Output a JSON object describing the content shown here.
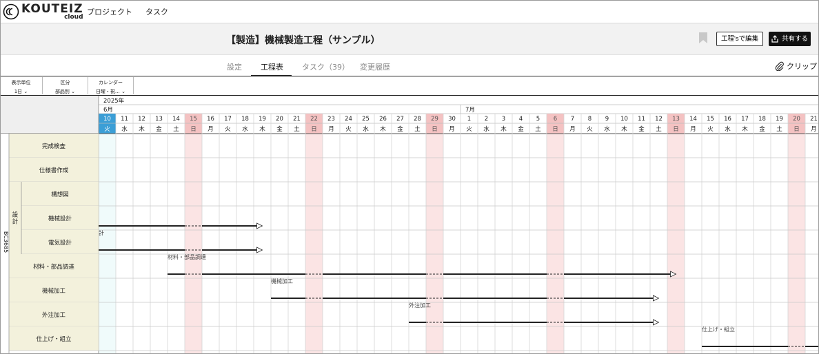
{
  "nav": {
    "logo_text": "KOUTEIZ",
    "logo_sub": "cloud",
    "items": [
      "プロジェクト",
      "タスク"
    ]
  },
  "header": {
    "title": "【製造】機械製造工程（サンプル）",
    "edit_button": "工程'sで編集",
    "share_button": "共有する"
  },
  "tabs": [
    {
      "label": "設定",
      "active": false
    },
    {
      "label": "工程表",
      "active": true
    },
    {
      "label": "タスク（39）",
      "active": false
    },
    {
      "label": "変更履歴",
      "active": false
    }
  ],
  "clip_label": "クリップ",
  "filters": [
    {
      "label": "表示単位",
      "value": "1日"
    },
    {
      "label": "区分",
      "value": "部品別"
    },
    {
      "label": "カレンダー",
      "value": "日曜・祝…"
    }
  ],
  "calendar": {
    "year": "2025年",
    "months": [
      {
        "label": "6月",
        "start_index": 0
      },
      {
        "label": "7月",
        "start_index": 21
      }
    ],
    "days": [
      {
        "d": "10",
        "w": "火",
        "type": "today"
      },
      {
        "d": "11",
        "w": "水"
      },
      {
        "d": "12",
        "w": "木"
      },
      {
        "d": "13",
        "w": "金"
      },
      {
        "d": "14",
        "w": "土"
      },
      {
        "d": "15",
        "w": "日",
        "type": "holiday"
      },
      {
        "d": "16",
        "w": "月"
      },
      {
        "d": "17",
        "w": "火"
      },
      {
        "d": "18",
        "w": "水"
      },
      {
        "d": "19",
        "w": "木"
      },
      {
        "d": "20",
        "w": "金"
      },
      {
        "d": "21",
        "w": "土"
      },
      {
        "d": "22",
        "w": "日",
        "type": "holiday"
      },
      {
        "d": "23",
        "w": "月"
      },
      {
        "d": "24",
        "w": "火"
      },
      {
        "d": "25",
        "w": "水"
      },
      {
        "d": "26",
        "w": "木"
      },
      {
        "d": "27",
        "w": "金"
      },
      {
        "d": "28",
        "w": "土"
      },
      {
        "d": "29",
        "w": "日",
        "type": "holiday"
      },
      {
        "d": "30",
        "w": "月"
      },
      {
        "d": "1",
        "w": "火"
      },
      {
        "d": "2",
        "w": "水"
      },
      {
        "d": "3",
        "w": "木"
      },
      {
        "d": "4",
        "w": "金"
      },
      {
        "d": "5",
        "w": "土"
      },
      {
        "d": "6",
        "w": "日",
        "type": "holiday"
      },
      {
        "d": "7",
        "w": "月"
      },
      {
        "d": "8",
        "w": "火"
      },
      {
        "d": "9",
        "w": "水"
      },
      {
        "d": "10",
        "w": "木"
      },
      {
        "d": "11",
        "w": "金"
      },
      {
        "d": "12",
        "w": "土"
      },
      {
        "d": "13",
        "w": "日",
        "type": "holiday"
      },
      {
        "d": "14",
        "w": "月"
      },
      {
        "d": "15",
        "w": "火"
      },
      {
        "d": "16",
        "w": "水"
      },
      {
        "d": "17",
        "w": "木"
      },
      {
        "d": "18",
        "w": "金"
      },
      {
        "d": "19",
        "w": "土"
      },
      {
        "d": "20",
        "w": "日",
        "type": "holiday"
      },
      {
        "d": "21",
        "w": "月"
      }
    ]
  },
  "group_label": "BC3685",
  "sub_group_label": "設計",
  "rows": [
    {
      "name": "完成検査",
      "sub": false
    },
    {
      "name": "仕様書作成",
      "sub": false
    },
    {
      "name": "構想図",
      "sub": true
    },
    {
      "name": "機械設計",
      "sub": true
    },
    {
      "name": "電気設計",
      "sub": true
    },
    {
      "name": "材料・部品調達",
      "sub": false
    },
    {
      "name": "機械加工",
      "sub": false
    },
    {
      "name": "外注加工",
      "sub": false
    },
    {
      "name": "仕上げ・組立",
      "sub": false
    }
  ],
  "bars": [
    {
      "row": 3,
      "start": 0,
      "end": 9,
      "label": ""
    },
    {
      "row": 4,
      "start": 0,
      "end": 9,
      "label": "計"
    },
    {
      "row": 5,
      "start": 4,
      "end": 33,
      "label": "材料・部品調達"
    },
    {
      "row": 6,
      "start": 10,
      "end": 32,
      "label": "機械加工"
    },
    {
      "row": 7,
      "start": 18,
      "end": 32,
      "label": "外注加工"
    },
    {
      "row": 8,
      "start": 35,
      "end": 42,
      "label": "仕上げ・組立"
    }
  ],
  "colors": {
    "today": "#3b9ed6",
    "today_col": "#f0fbfb",
    "holiday_head": "#f4c2c2",
    "holiday_col": "#fbe4e4",
    "row_label_bg": "#f3f1dc",
    "header_bg": "#efefef",
    "bar": "#222222"
  }
}
